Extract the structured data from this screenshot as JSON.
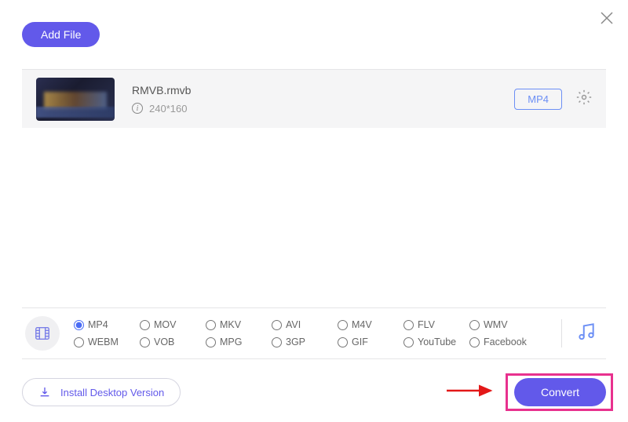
{
  "buttons": {
    "add_file": "Add File",
    "install_desktop": "Install Desktop Version",
    "convert": "Convert"
  },
  "file": {
    "name": "RMVB.rmvb",
    "resolution": "240*160",
    "target_format": "MP4"
  },
  "formats": {
    "selected": "MP4",
    "row1": [
      {
        "value": "MP4",
        "label": "MP4"
      },
      {
        "value": "MOV",
        "label": "MOV"
      },
      {
        "value": "MKV",
        "label": "MKV"
      },
      {
        "value": "AVI",
        "label": "AVI"
      },
      {
        "value": "M4V",
        "label": "M4V"
      },
      {
        "value": "FLV",
        "label": "FLV"
      },
      {
        "value": "WMV",
        "label": "WMV"
      }
    ],
    "row2": [
      {
        "value": "WEBM",
        "label": "WEBM"
      },
      {
        "value": "VOB",
        "label": "VOB"
      },
      {
        "value": "MPG",
        "label": "MPG"
      },
      {
        "value": "3GP",
        "label": "3GP"
      },
      {
        "value": "GIF",
        "label": "GIF"
      },
      {
        "value": "YouTube",
        "label": "YouTube"
      },
      {
        "value": "Facebook",
        "label": "Facebook"
      }
    ]
  }
}
